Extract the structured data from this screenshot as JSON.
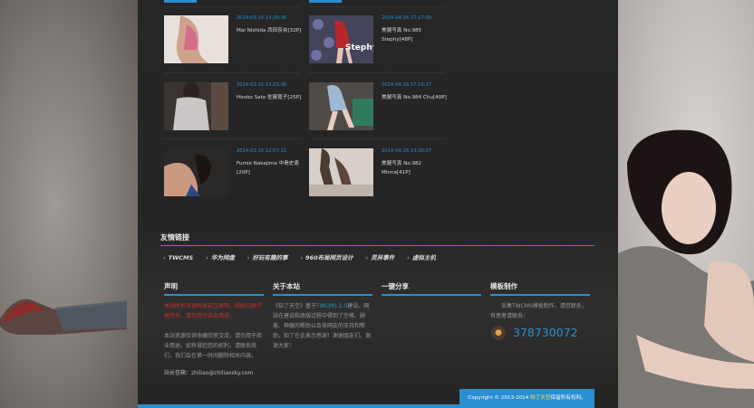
{
  "posts": [
    {
      "date": "2014-03-15 13:26:36",
      "title": "Mai Nishida 西田奈央[32P]",
      "img": "photo-pink-dress",
      "overlay": ""
    },
    {
      "date": "2014-04-26 17:17:00",
      "title": "美腿写真 No.985 Stephy[48P]",
      "img": "photo-red-dress",
      "overlay": "Stephy"
    },
    {
      "date": "2014-03-15 13:23:06",
      "title": "Hiroko Sato 佐藤寛子[25P]",
      "img": "photo-lace-top",
      "overlay": ""
    },
    {
      "date": "2014-04-26 17:15:37",
      "title": "美腿写真 No.984 Chu[40P]",
      "img": "photo-blue-dress",
      "overlay": ""
    },
    {
      "date": "2014-03-15 12:57:11",
      "title": "Fumie Nakajima 中島史恵 [20P]",
      "img": "photo-dark-room",
      "overlay": ""
    },
    {
      "date": "2014-04-26 13:30:07",
      "title": "美腿写真 No.982 Minna[41P]",
      "img": "photo-stockings",
      "overlay": ""
    }
  ],
  "friend_links": {
    "title": "友情链接",
    "items": [
      "TWCMS",
      "华为网盘",
      "好玩有趣的事",
      "960布局网页设计",
      "灵异事件",
      "虚拟主机"
    ]
  },
  "footer": {
    "statement": {
      "title": "声明",
      "red_text": "本站所有资源均来自互联网，版权归原作者所有，请勿用于商业用途。",
      "text": "本站资源仅供收藏欣赏交流，请勿用于商业用途。如有侵犯您的权利，请联系我们，我们会在第一时间删除相关内容。",
      "contact": "站长信箱：zhiliao@zhiliaosky.com"
    },
    "about": {
      "title": "关于本站",
      "text_pre": "《知了天空》基于",
      "text_link": "TWCMS 2.0",
      "text_post": "建设。网站在建设和改版过程中得到了空格、顾客、神器的帮助以及各网友的支持和帮助，知了在此表示感谢！谢谢朋友们，谢谢大家！"
    },
    "share": {
      "title": "一键分享"
    },
    "template": {
      "title": "模板制作",
      "text": "采集TWCMS模板制作，请您联系，有意者请联系：",
      "qq": "378730072",
      "qq_icon": "penguin-icon"
    }
  },
  "copyright": {
    "prefix": "Copyright © 2013-2014",
    "name": "知了天空",
    "suffix": "保留所有权利。"
  },
  "colors": {
    "accent": "#2a8fd1",
    "bg": "#262626",
    "red": "#c8302c",
    "highlight": "#f3e95a"
  }
}
